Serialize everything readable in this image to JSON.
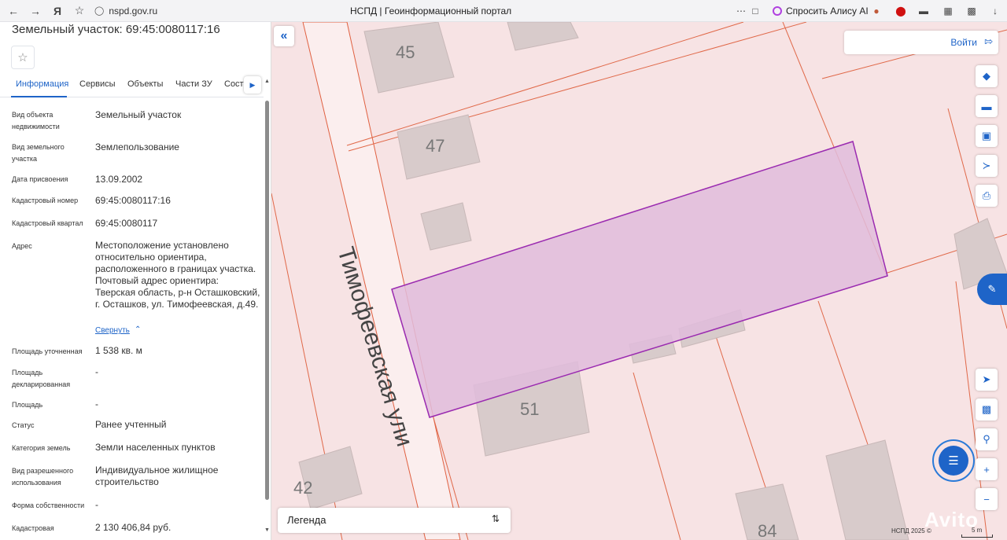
{
  "browser": {
    "url": "nspd.gov.ru",
    "tab_title": "НСПД | Геоинформационный портал",
    "alice_label": "Спросить Алису AI"
  },
  "panel": {
    "title": "Земельный участок: 69:45:0080117:16",
    "tabs": [
      "Информация",
      "Сервисы",
      "Объекты",
      "Части ЗУ",
      "Соста"
    ],
    "rows": [
      {
        "label": "Вид объекта недвижимости",
        "value": "Земельный участок"
      },
      {
        "label": "Вид земельного участка",
        "value": "Землепользование"
      },
      {
        "label": "Дата присвоения",
        "value": "13.09.2002"
      },
      {
        "label": "Кадастровый номер",
        "value": "69:45:0080117:16"
      },
      {
        "label": "Кадастровый квартал",
        "value": "69:45:0080117"
      },
      {
        "label": "Адрес",
        "value": "Местоположение установлено относительно ориентира, расположенного в границах участка. Почтовый адрес ориентира: Тверская область, р-н Осташковский, г. Осташков, ул. Тимофеевская, д.49."
      },
      {
        "label": "Площадь уточненная",
        "value": "1 538 кв. м"
      },
      {
        "label": "Площадь декларированная",
        "value": "-"
      },
      {
        "label": "Площадь",
        "value": "-"
      },
      {
        "label": "Статус",
        "value": "Ранее учтенный"
      },
      {
        "label": "Категория земель",
        "value": "Земли населенных пунктов"
      },
      {
        "label": "Вид разрешенного использования",
        "value": "Индивидуальное жилищное строительство"
      },
      {
        "label": "Форма собственности",
        "value": "-"
      },
      {
        "label": "Кадастровая",
        "value": "2 130 406,84 руб."
      }
    ],
    "collapse_link": "Свернуть"
  },
  "map": {
    "street_label": "Тимофеевская  ули",
    "house_numbers": [
      "45",
      "47",
      "51",
      "42",
      "84"
    ],
    "login_label": "Войти",
    "legend_label": "Легенда",
    "copyright": "НСПД 2025 ©",
    "scale": "5 m",
    "watermark": "Avito",
    "highlight_color": "#e0bcdc",
    "highlight_border": "#9a2ab0"
  },
  "icons": {
    "layers": "layers-icon",
    "ruler": "ruler-icon",
    "select": "select-area-icon",
    "share": "share-icon",
    "print": "print-icon",
    "locate": "locate-icon",
    "minimap": "minimap-icon",
    "geo": "geo-search-icon",
    "zoom_in": "zoom-in-icon",
    "zoom_out": "zoom-out-icon"
  }
}
